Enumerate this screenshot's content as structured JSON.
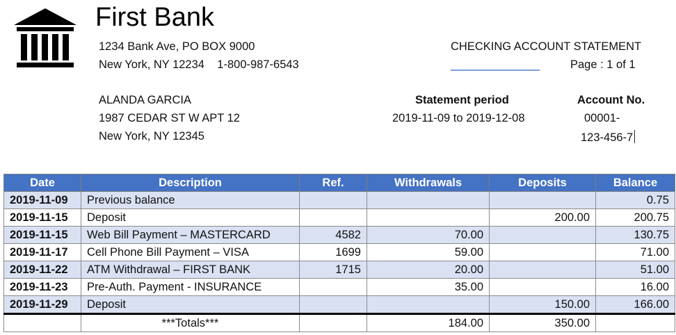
{
  "bank": {
    "name": "First Bank",
    "address_line1": "1234 Bank Ave, PO BOX 9000",
    "address_line2": "New York, NY 12234    1-800-987-6543",
    "logo_icon": "bank-building-icon"
  },
  "statement": {
    "title": "CHECKING ACCOUNT STATEMENT",
    "page": "Page : 1 of 1",
    "period_label": "Statement period",
    "period_value": "2019-11-09 to 2019-12-08",
    "account_label": "Account No.",
    "account_value_line1": "00001-",
    "account_value_line2": "123-456-7"
  },
  "customer": {
    "name": "ALANDA GARCIA",
    "street": "1987 CEDAR ST W APT 12",
    "city": "New York, NY 12345"
  },
  "table": {
    "headers": [
      "Date",
      "Description",
      "Ref.",
      "Withdrawals",
      "Deposits",
      "Balance"
    ],
    "rows": [
      [
        "2019-11-09",
        "Previous balance",
        "",
        "",
        "",
        "0.75"
      ],
      [
        "2019-11-15",
        "Deposit",
        "",
        "",
        "200.00",
        "200.75"
      ],
      [
        "2019-11-15",
        "Web Bill Payment – MASTERCARD",
        "4582",
        "70.00",
        "",
        "130.75"
      ],
      [
        "2019-11-17",
        "Cell Phone Bill Payment – VISA",
        "1699",
        "59.00",
        "",
        "71.00"
      ],
      [
        "2019-11-22",
        "ATM Withdrawal – FIRST BANK",
        "1715",
        "20.00",
        "",
        "51.00"
      ],
      [
        "2019-11-23",
        "Pre-Auth. Payment - INSURANCE",
        "",
        "35.00",
        "",
        "16.00"
      ],
      [
        "2019-11-29",
        "Deposit",
        "",
        "",
        "150.00",
        "166.00"
      ]
    ],
    "totals": {
      "label": "***Totals***",
      "withdrawals": "184.00",
      "deposits": "350.00"
    }
  },
  "colors": {
    "header_bg": "#4472c4",
    "row_shade": "#d9e1f2"
  }
}
